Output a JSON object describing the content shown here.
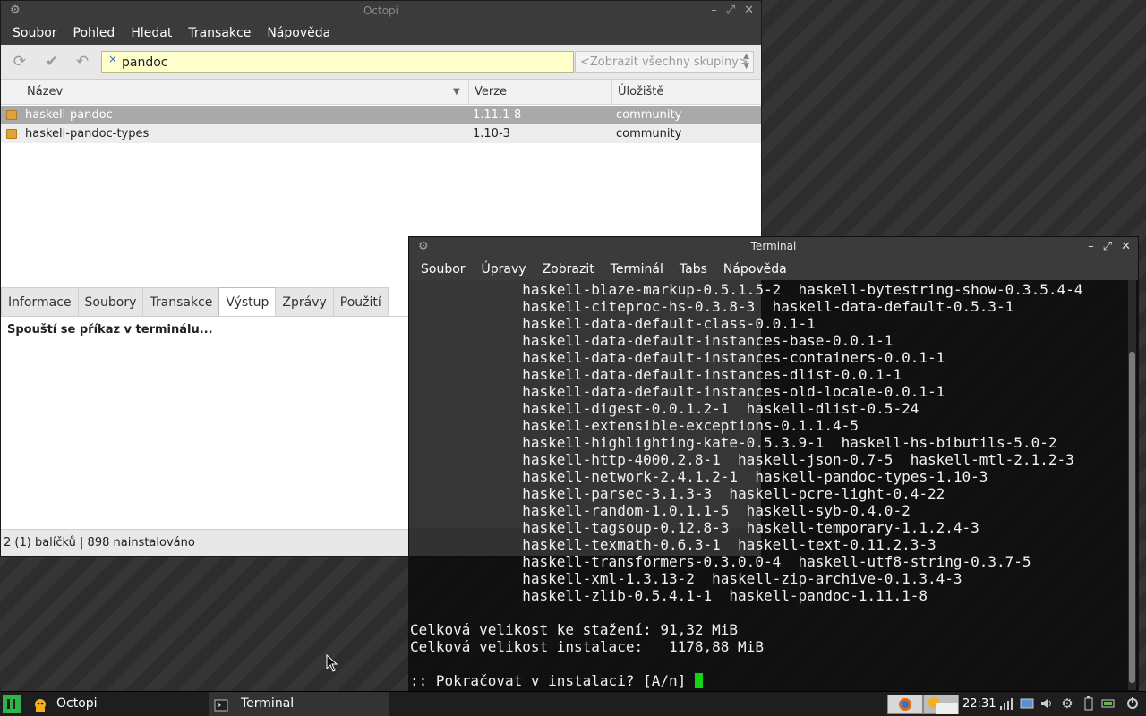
{
  "octopi": {
    "title": "Octopi",
    "menu": [
      "Soubor",
      "Pohled",
      "Hledat",
      "Transakce",
      "Nápověda"
    ],
    "search": {
      "value": "pandoc",
      "clear_icon": "×"
    },
    "group_select": {
      "value": "<Zobrazit všechny skupiny>"
    },
    "columns": {
      "name": "Název",
      "version": "Verze",
      "repo": "Úložiště"
    },
    "packages": [
      {
        "name": "haskell-pandoc",
        "version": "1.11.1-8",
        "repo": "community"
      },
      {
        "name": "haskell-pandoc-types",
        "version": "1.10-3",
        "repo": "community"
      }
    ],
    "tabs": [
      "Informace",
      "Soubory",
      "Transakce",
      "Výstup",
      "Zprávy",
      "Použití"
    ],
    "active_tab": "Výstup",
    "output_text": "Spouští se příkaz v terminálu...",
    "status": "2 (1) balíčků  | 898 nainstalováno"
  },
  "terminal": {
    "title": "Terminal",
    "menu": [
      "Soubor",
      "Úpravy",
      "Zobrazit",
      "Terminál",
      "Tabs",
      "Nápověda"
    ],
    "lines": [
      "             haskell-blaze-markup-0.5.1.5-2  haskell-bytestring-show-0.3.5.4-4",
      "             haskell-citeproc-hs-0.3.8-3  haskell-data-default-0.5.3-1",
      "             haskell-data-default-class-0.0.1-1",
      "             haskell-data-default-instances-base-0.0.1-1",
      "             haskell-data-default-instances-containers-0.0.1-1",
      "             haskell-data-default-instances-dlist-0.0.1-1",
      "             haskell-data-default-instances-old-locale-0.0.1-1",
      "             haskell-digest-0.0.1.2-1  haskell-dlist-0.5-24",
      "             haskell-extensible-exceptions-0.1.1.4-5",
      "             haskell-highlighting-kate-0.5.3.9-1  haskell-hs-bibutils-5.0-2",
      "             haskell-http-4000.2.8-1  haskell-json-0.7-5  haskell-mtl-2.1.2-3",
      "             haskell-network-2.4.1.2-1  haskell-pandoc-types-1.10-3",
      "             haskell-parsec-3.1.3-3  haskell-pcre-light-0.4-22",
      "             haskell-random-1.0.1.1-5  haskell-syb-0.4.0-2",
      "             haskell-tagsoup-0.12.8-3  haskell-temporary-1.1.2.4-3",
      "             haskell-texmath-0.6.3-1  haskell-text-0.11.2.3-3",
      "             haskell-transformers-0.3.0.0-4  haskell-utf8-string-0.3.7-5",
      "             haskell-xml-1.3.13-2  haskell-zip-archive-0.1.3.4-3",
      "             haskell-zlib-0.5.4.1-1  haskell-pandoc-1.11.1-8",
      "",
      "Celková velikost ke stažení: 91,32 MiB",
      "Celková velikost instalace:   1178,88 MiB",
      ""
    ],
    "prompt": ":: Pokračovat v instalaci? [A/n] "
  },
  "taskbar": {
    "tasks": [
      "Octopi",
      "Terminal"
    ],
    "clock": "22:31"
  },
  "icons": {
    "gear": "⚙",
    "minimize": "–",
    "maximize": "⤢",
    "close": "✕",
    "sort_down": "▼",
    "refresh": "⟳",
    "commit": "✔",
    "rollback": "↶"
  }
}
